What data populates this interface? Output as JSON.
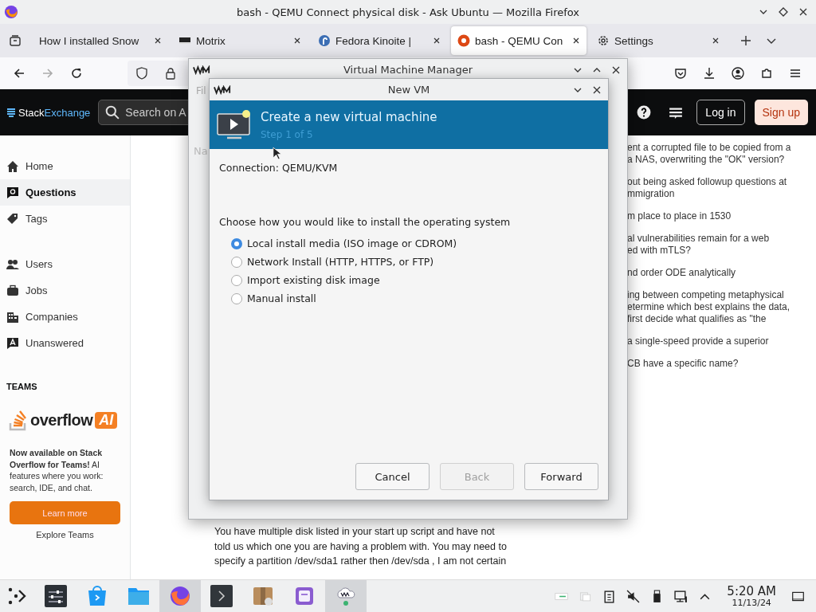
{
  "window": {
    "title": "bash - QEMU Connect physical disk - Ask Ubuntu — Mozilla Firefox"
  },
  "tabs": [
    {
      "label": "How I installed Snow",
      "kind": "page",
      "selected": false
    },
    {
      "label": "Motrix",
      "kind": "motrix",
      "selected": false
    },
    {
      "label": "Fedora Kinoite |",
      "kind": "fedora",
      "selected": false
    },
    {
      "label": "bash - QEMU Con",
      "kind": "askubuntu",
      "selected": true
    },
    {
      "label": "Settings",
      "kind": "settings",
      "selected": false
    }
  ],
  "site": {
    "logo_left": "Stack",
    "logo_right": "Exchange",
    "search_placeholder": "Search on A",
    "login": "Log in",
    "signup": "Sign up"
  },
  "sidebar": {
    "groups": [
      {
        "items": [
          {
            "label": "Home",
            "kind": "home",
            "selected": false
          },
          {
            "label": "Questions",
            "kind": "questions",
            "selected": true
          },
          {
            "label": "Tags",
            "kind": "tags",
            "selected": false
          }
        ]
      },
      {
        "items": [
          {
            "label": "Users",
            "kind": "users",
            "selected": false
          },
          {
            "label": "Jobs",
            "kind": "jobs",
            "selected": false
          },
          {
            "label": "Companies",
            "kind": "companies",
            "selected": false
          },
          {
            "label": "Unanswered",
            "kind": "unanswered",
            "selected": false
          }
        ]
      }
    ],
    "teams_heading": "TEAMS",
    "promo_logo": "overflow",
    "promo_badge": "AI",
    "promo_text": "**Now available on Stack Overflow for Teams!** AI features where you work: search, IDE, and chat.",
    "learn_more": "Learn more",
    "explore": "Explore Teams"
  },
  "hot_questions": [
    {
      "lines": [
        "ent a corrupted file to be copied from a",
        "a NAS, overwriting the \"OK\" version?"
      ]
    },
    {
      "lines": [
        "out being asked followup questions at",
        "mmigration"
      ]
    },
    {
      "lines": [
        "m place to place in 1530"
      ]
    },
    {
      "lines": [
        "al vulnerabilities remain for a web",
        "ed with mTLS?"
      ]
    },
    {
      "lines": [
        "nd order ODE analytically"
      ]
    },
    {
      "lines": [
        "ing between competing metaphysical",
        "etermine which best explains the data,",
        "first decide what qualifies as \"the"
      ]
    },
    {
      "lines": [
        "a single-speed provide a superior"
      ]
    },
    {
      "lines": [
        "CB have a specific name?"
      ]
    }
  ],
  "answer": {
    "lines": [
      "You have multiple disk listed in your start up script and have not",
      "told us which one you are having a problem with. You may need to",
      "specify a partition /dev/sda1 rather then /dev/sda , I am not certain"
    ]
  },
  "vmm": {
    "title": "Virtual Machine Manager",
    "menu_fragment": "Fil",
    "label_fragment": "Na"
  },
  "dialog": {
    "title": "New VM",
    "header_title": "Create a new virtual machine",
    "header_step": "Step 1 of 5",
    "connection": "Connection: QEMU/KVM",
    "prompt": "Choose how you would like to install the operating system",
    "options": [
      {
        "label": "Local install media (ISO image or CDROM)",
        "selected": true
      },
      {
        "label": "Network Install (HTTP, HTTPS, or FTP)",
        "selected": false
      },
      {
        "label": "Import existing disk image",
        "selected": false
      },
      {
        "label": "Manual install",
        "selected": false
      }
    ],
    "buttons": [
      {
        "label": "Cancel",
        "disabled": false
      },
      {
        "label": "Back",
        "disabled": true
      },
      {
        "label": "Forward",
        "disabled": false
      }
    ]
  },
  "taskbar": {
    "apps": [
      {
        "kind": "launcher",
        "active": false
      },
      {
        "kind": "mixer",
        "active": false
      },
      {
        "kind": "store",
        "active": false
      },
      {
        "kind": "files",
        "active": false
      },
      {
        "kind": "firefox",
        "active": true
      },
      {
        "kind": "terminal",
        "active": false
      },
      {
        "kind": "archive",
        "active": false
      },
      {
        "kind": "notes",
        "active": false
      },
      {
        "kind": "vmm",
        "active": true
      }
    ],
    "time": "5:20 AM",
    "date": "11/13/24"
  }
}
